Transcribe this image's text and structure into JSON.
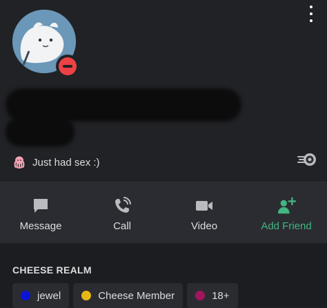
{
  "profile": {
    "status_text": "Just had sex :)",
    "status_emoji": "octopus-emoji",
    "presence": "do-not-disturb",
    "presence_color": "#ed4245"
  },
  "actions": [
    {
      "label": "Message",
      "icon": "message-icon"
    },
    {
      "label": "Call",
      "icon": "phone-icon"
    },
    {
      "label": "Video",
      "icon": "video-camera-icon"
    },
    {
      "label": "Add Friend",
      "icon": "add-friend-icon",
      "color": "#43b581"
    }
  ],
  "guild": {
    "name": "CHEESE REALM",
    "roles": [
      {
        "name": "jewel",
        "color": "#0a14d6"
      },
      {
        "name": "Cheese Member",
        "color": "#e5b717"
      },
      {
        "name": "18+",
        "color": "#a1155c"
      }
    ]
  }
}
